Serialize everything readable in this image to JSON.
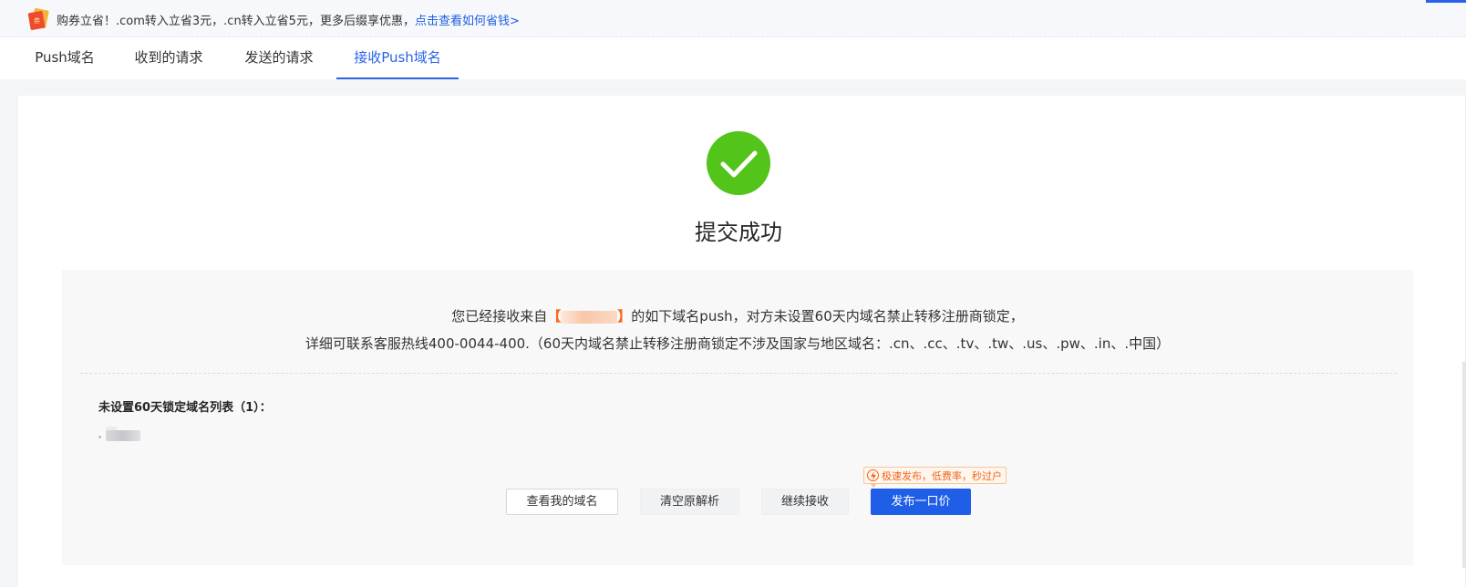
{
  "promo": {
    "text": "购券立省！.com转入立省3元，.cn转入立省5元，更多后缀享优惠，",
    "link": "点击查看如何省钱>",
    "icon": "coupon-icon"
  },
  "tabs": [
    {
      "label": "Push域名",
      "active": false
    },
    {
      "label": "收到的请求",
      "active": false
    },
    {
      "label": "发送的请求",
      "active": false
    },
    {
      "label": "接收Push域名",
      "active": true
    }
  ],
  "result": {
    "icon": "check-circle-icon",
    "title": "提交成功"
  },
  "info": {
    "line1_prefix": "您已经接收来自",
    "bracket_open": "【",
    "bracket_close": "】",
    "line1_suffix": "的如下域名push，对方未设置60天内域名禁止转移注册商锁定，",
    "line2": "详细可联系客服热线400-0044-400.（60天内域名禁止转移注册商锁定不涉及国家与地区域名：.cn、.cc、.tv、.tw、.us、.pw、.in、.中国）"
  },
  "list": {
    "title": "未设置60天锁定域名列表（1）："
  },
  "badge": {
    "text": "极速发布，低费率，秒过户",
    "icon": "lightning-icon"
  },
  "buttons": {
    "view_domains": "查看我的域名",
    "clear_dns": "清空原解析",
    "continue_receive": "继续接收",
    "publish_price": "发布一口价"
  },
  "colors": {
    "primary": "#1f5fe8",
    "success": "#52c41a",
    "accent_orange": "#f56c1d"
  }
}
